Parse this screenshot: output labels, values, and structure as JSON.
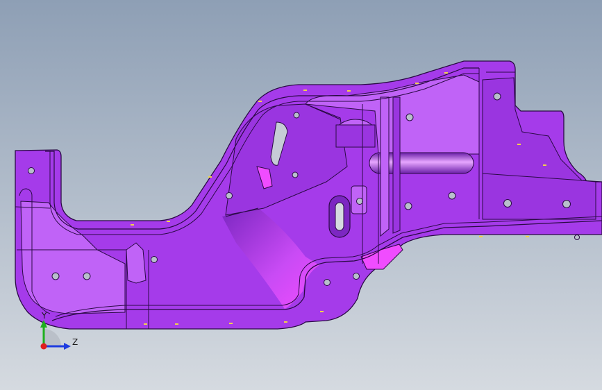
{
  "viewport": {
    "background_top": "#8E9FB5",
    "background_bottom": "#D5DAE0"
  },
  "part": {
    "fill_color": "#A53BEA",
    "highlight_color": "#D86CFF",
    "shadow_color": "#6A1FA8",
    "edge_color": "#2A0A45",
    "bright_color": "#F04CFF"
  },
  "triad": {
    "y_label": "Y",
    "z_label": "Z",
    "x_color": "#E01E1E",
    "y_color": "#1EB01E",
    "z_color": "#1E3CE0"
  }
}
